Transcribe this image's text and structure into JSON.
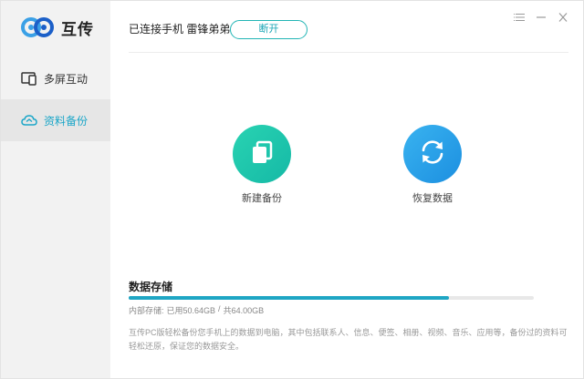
{
  "app": {
    "name": "互传"
  },
  "sidebar": {
    "items": [
      {
        "label": "多屏互动",
        "icon": "screen-mirror-icon",
        "active": false
      },
      {
        "label": "资料备份",
        "icon": "cloud-backup-icon",
        "active": true
      }
    ]
  },
  "header": {
    "status": "已连接手机 雷锋弟弟",
    "disconnect_label": "断开"
  },
  "actions": {
    "backup_label": "新建备份",
    "restore_label": "恢复数据"
  },
  "storage": {
    "title": "数据存储",
    "label": "内部存储:",
    "used": "已用50.64GB",
    "separator": "/",
    "total": "共64.00GB",
    "used_fraction": 0.79,
    "description": "互传PC版轻松备份您手机上的数据到电脑，其中包括联系人、信息、便签、相册、视频、音乐、应用等，备份过的资料可轻松还原，保证您的数据安全。"
  },
  "colors": {
    "accent": "#1fa6c4",
    "backup_green": "#1fc4ac",
    "restore_blue": "#2a9fe8"
  }
}
